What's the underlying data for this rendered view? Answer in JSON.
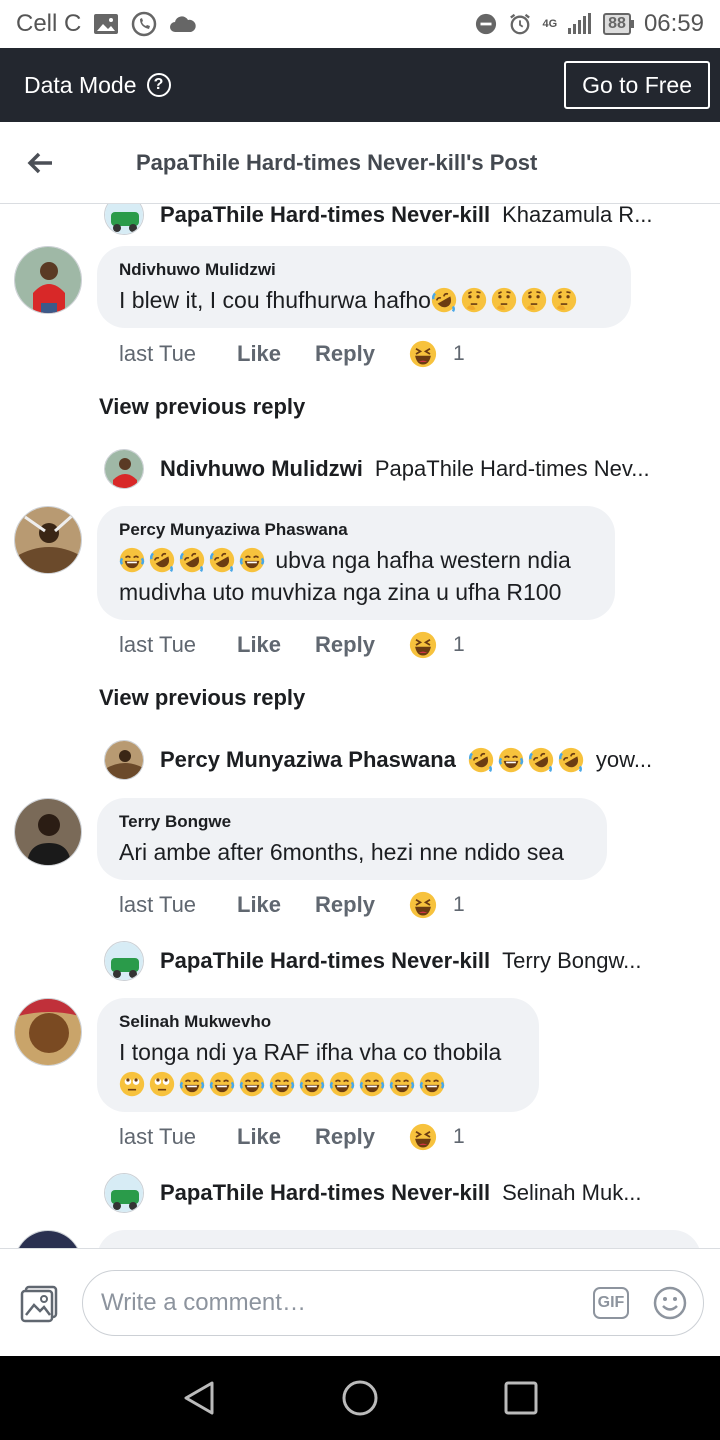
{
  "status_bar": {
    "carrier": "Cell C",
    "network": "4G",
    "battery": "88",
    "time": "06:59"
  },
  "data_bar": {
    "label": "Data Mode",
    "button": "Go to Free"
  },
  "header": {
    "title": "PapaThile Hard-times Never-kill's Post"
  },
  "reply_top": {
    "name": "PapaThile Hard-times Never-kill",
    "text": "Khazamula R..."
  },
  "comments": [
    {
      "name": "Ndivhuwo Mulidzwi",
      "text": "I blew it, I cou fhufhurwa hafho",
      "emojis": [
        "rofl",
        "think",
        "think",
        "think",
        "think"
      ],
      "time": "last Tue",
      "like": "Like",
      "reply": "Reply",
      "reaction_count": "1"
    },
    {
      "name": "Percy Munyaziwa Phaswana",
      "text_line1": "ubva nga hafha western ndia",
      "text_line2": "mudivha uto muvhiza nga zina u ufha R100",
      "emojis": [
        "joy",
        "rofl",
        "rofl",
        "rofl",
        "joy"
      ],
      "time": "last Tue",
      "like": "Like",
      "reply": "Reply",
      "reaction_count": "1"
    },
    {
      "name": "Terry Bongwe",
      "text": "Ari ambe after 6months, hezi nne ndido sea",
      "time": "last Tue",
      "like": "Like",
      "reply": "Reply",
      "reaction_count": "1"
    },
    {
      "name": "Selinah Mukwevho",
      "text": "I tonga ndi ya RAF ifha vha co thobila",
      "emojis": [
        "roll",
        "roll",
        "joy",
        "joy",
        "joy",
        "joy",
        "joy",
        "joy",
        "joy",
        "joy",
        "joy"
      ],
      "time": "last Tue",
      "like": "Like",
      "reply": "Reply",
      "reaction_count": "1"
    }
  ],
  "view_previous": "View previous reply",
  "replies": [
    {
      "name": "Ndivhuwo Mulidzwi",
      "text": "PapaThile Hard-times Nev..."
    },
    {
      "name": "Percy Munyaziwa Phaswana",
      "text": "yow...",
      "emojis": [
        "rofl",
        "joy",
        "rofl",
        "rofl"
      ]
    },
    {
      "name": "PapaThile Hard-times Never-kill",
      "text": "Terry Bongw..."
    },
    {
      "name": "PapaThile Hard-times Never-kill",
      "text": "Selinah Muk..."
    }
  ],
  "composer": {
    "placeholder": "Write a comment…",
    "gif": "GIF"
  },
  "colors": {
    "data_bar_bg": "#23272f",
    "bubble_bg": "#f0f2f5",
    "secondary_text": "#606770"
  }
}
